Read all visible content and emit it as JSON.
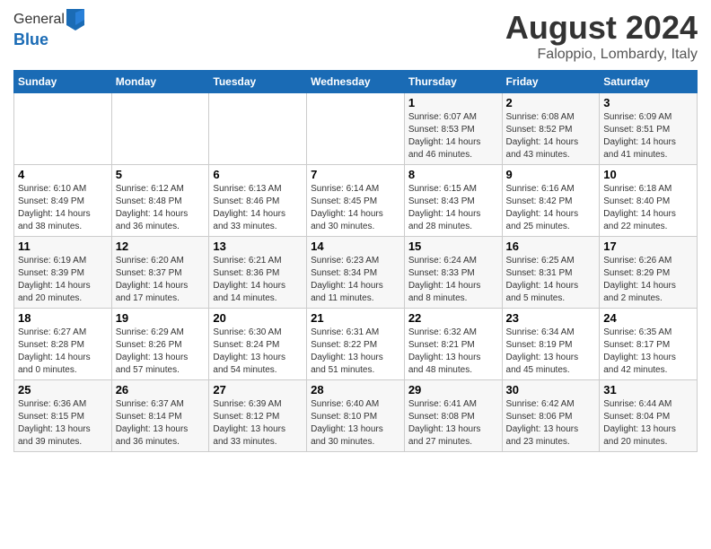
{
  "header": {
    "logo_line1": "General",
    "logo_line2": "Blue",
    "main_title": "August 2024",
    "subtitle": "Faloppio, Lombardy, Italy"
  },
  "columns": [
    "Sunday",
    "Monday",
    "Tuesday",
    "Wednesday",
    "Thursday",
    "Friday",
    "Saturday"
  ],
  "weeks": [
    [
      {
        "day": "",
        "detail": ""
      },
      {
        "day": "",
        "detail": ""
      },
      {
        "day": "",
        "detail": ""
      },
      {
        "day": "",
        "detail": ""
      },
      {
        "day": "1",
        "detail": "Sunrise: 6:07 AM\nSunset: 8:53 PM\nDaylight: 14 hours\nand 46 minutes."
      },
      {
        "day": "2",
        "detail": "Sunrise: 6:08 AM\nSunset: 8:52 PM\nDaylight: 14 hours\nand 43 minutes."
      },
      {
        "day": "3",
        "detail": "Sunrise: 6:09 AM\nSunset: 8:51 PM\nDaylight: 14 hours\nand 41 minutes."
      }
    ],
    [
      {
        "day": "4",
        "detail": "Sunrise: 6:10 AM\nSunset: 8:49 PM\nDaylight: 14 hours\nand 38 minutes."
      },
      {
        "day": "5",
        "detail": "Sunrise: 6:12 AM\nSunset: 8:48 PM\nDaylight: 14 hours\nand 36 minutes."
      },
      {
        "day": "6",
        "detail": "Sunrise: 6:13 AM\nSunset: 8:46 PM\nDaylight: 14 hours\nand 33 minutes."
      },
      {
        "day": "7",
        "detail": "Sunrise: 6:14 AM\nSunset: 8:45 PM\nDaylight: 14 hours\nand 30 minutes."
      },
      {
        "day": "8",
        "detail": "Sunrise: 6:15 AM\nSunset: 8:43 PM\nDaylight: 14 hours\nand 28 minutes."
      },
      {
        "day": "9",
        "detail": "Sunrise: 6:16 AM\nSunset: 8:42 PM\nDaylight: 14 hours\nand 25 minutes."
      },
      {
        "day": "10",
        "detail": "Sunrise: 6:18 AM\nSunset: 8:40 PM\nDaylight: 14 hours\nand 22 minutes."
      }
    ],
    [
      {
        "day": "11",
        "detail": "Sunrise: 6:19 AM\nSunset: 8:39 PM\nDaylight: 14 hours\nand 20 minutes."
      },
      {
        "day": "12",
        "detail": "Sunrise: 6:20 AM\nSunset: 8:37 PM\nDaylight: 14 hours\nand 17 minutes."
      },
      {
        "day": "13",
        "detail": "Sunrise: 6:21 AM\nSunset: 8:36 PM\nDaylight: 14 hours\nand 14 minutes."
      },
      {
        "day": "14",
        "detail": "Sunrise: 6:23 AM\nSunset: 8:34 PM\nDaylight: 14 hours\nand 11 minutes."
      },
      {
        "day": "15",
        "detail": "Sunrise: 6:24 AM\nSunset: 8:33 PM\nDaylight: 14 hours\nand 8 minutes."
      },
      {
        "day": "16",
        "detail": "Sunrise: 6:25 AM\nSunset: 8:31 PM\nDaylight: 14 hours\nand 5 minutes."
      },
      {
        "day": "17",
        "detail": "Sunrise: 6:26 AM\nSunset: 8:29 PM\nDaylight: 14 hours\nand 2 minutes."
      }
    ],
    [
      {
        "day": "18",
        "detail": "Sunrise: 6:27 AM\nSunset: 8:28 PM\nDaylight: 14 hours\nand 0 minutes."
      },
      {
        "day": "19",
        "detail": "Sunrise: 6:29 AM\nSunset: 8:26 PM\nDaylight: 13 hours\nand 57 minutes."
      },
      {
        "day": "20",
        "detail": "Sunrise: 6:30 AM\nSunset: 8:24 PM\nDaylight: 13 hours\nand 54 minutes."
      },
      {
        "day": "21",
        "detail": "Sunrise: 6:31 AM\nSunset: 8:22 PM\nDaylight: 13 hours\nand 51 minutes."
      },
      {
        "day": "22",
        "detail": "Sunrise: 6:32 AM\nSunset: 8:21 PM\nDaylight: 13 hours\nand 48 minutes."
      },
      {
        "day": "23",
        "detail": "Sunrise: 6:34 AM\nSunset: 8:19 PM\nDaylight: 13 hours\nand 45 minutes."
      },
      {
        "day": "24",
        "detail": "Sunrise: 6:35 AM\nSunset: 8:17 PM\nDaylight: 13 hours\nand 42 minutes."
      }
    ],
    [
      {
        "day": "25",
        "detail": "Sunrise: 6:36 AM\nSunset: 8:15 PM\nDaylight: 13 hours\nand 39 minutes."
      },
      {
        "day": "26",
        "detail": "Sunrise: 6:37 AM\nSunset: 8:14 PM\nDaylight: 13 hours\nand 36 minutes."
      },
      {
        "day": "27",
        "detail": "Sunrise: 6:39 AM\nSunset: 8:12 PM\nDaylight: 13 hours\nand 33 minutes."
      },
      {
        "day": "28",
        "detail": "Sunrise: 6:40 AM\nSunset: 8:10 PM\nDaylight: 13 hours\nand 30 minutes."
      },
      {
        "day": "29",
        "detail": "Sunrise: 6:41 AM\nSunset: 8:08 PM\nDaylight: 13 hours\nand 27 minutes."
      },
      {
        "day": "30",
        "detail": "Sunrise: 6:42 AM\nSunset: 8:06 PM\nDaylight: 13 hours\nand 23 minutes."
      },
      {
        "day": "31",
        "detail": "Sunrise: 6:44 AM\nSunset: 8:04 PM\nDaylight: 13 hours\nand 20 minutes."
      }
    ]
  ]
}
